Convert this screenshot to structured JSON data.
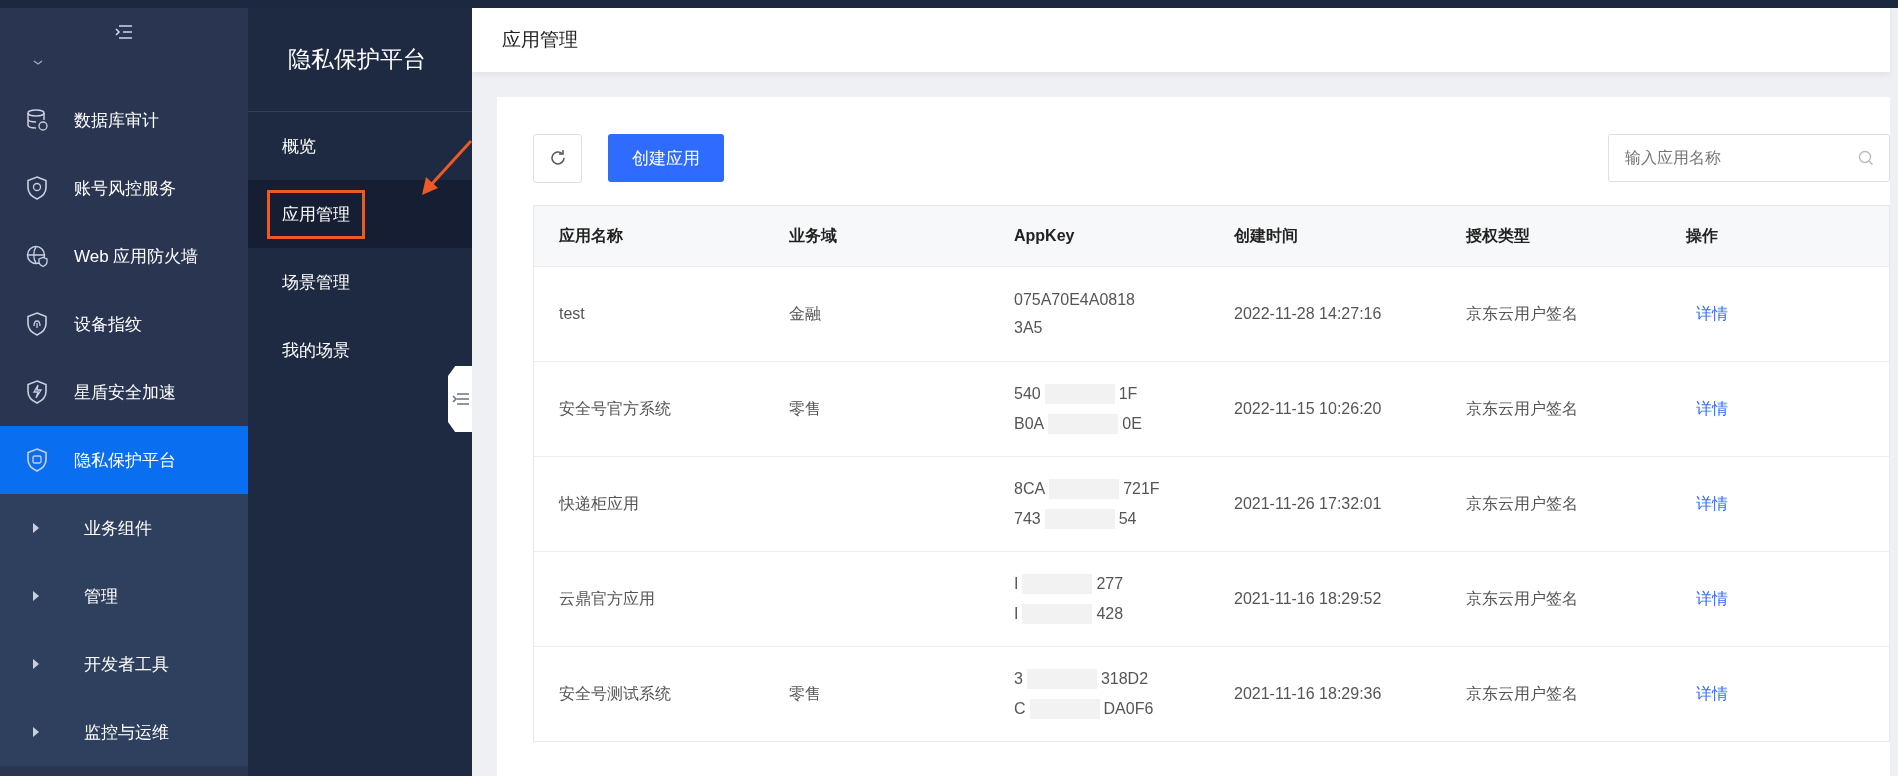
{
  "sidebar": {
    "items": [
      {
        "label": "数据库审计",
        "kind": "service",
        "selected": false
      },
      {
        "label": "账号风控服务",
        "kind": "service",
        "selected": false
      },
      {
        "label": "Web 应用防火墙",
        "kind": "service",
        "selected": false
      },
      {
        "label": "设备指纹",
        "kind": "service",
        "selected": false
      },
      {
        "label": "星盾安全加速",
        "kind": "service",
        "selected": false
      },
      {
        "label": "隐私保护平台",
        "kind": "service",
        "selected": true
      },
      {
        "label": "业务组件",
        "kind": "group",
        "expanded": false
      },
      {
        "label": "管理",
        "kind": "group",
        "expanded": false
      },
      {
        "label": "开发者工具",
        "kind": "group",
        "expanded": false
      },
      {
        "label": "监控与运维",
        "kind": "group",
        "expanded": false
      }
    ]
  },
  "subnav": {
    "title": "隐私保护平台",
    "items": [
      {
        "label": "概览",
        "selected": false,
        "annotated": false
      },
      {
        "label": "应用管理",
        "selected": true,
        "annotated": true
      },
      {
        "label": "场景管理",
        "selected": false,
        "annotated": false
      },
      {
        "label": "我的场景",
        "selected": false,
        "annotated": false
      }
    ]
  },
  "page": {
    "title": "应用管理"
  },
  "toolbar": {
    "create_button": "创建应用",
    "search": {
      "placeholder": "输入应用名称"
    }
  },
  "table": {
    "columns": [
      "应用名称",
      "业务域",
      "AppKey",
      "创建时间",
      "授权类型",
      "操作"
    ],
    "rows": [
      {
        "name": "test",
        "domain": "金融",
        "appkey": [
          [
            "075A70E4A0818"
          ],
          [
            "3A5"
          ]
        ],
        "created": "2022-11-28 14:27:16",
        "auth": "京东云用户签名",
        "action": "详情"
      },
      {
        "name": "安全号官方系统",
        "domain": "零售",
        "appkey": [
          [
            "540",
            "1F"
          ],
          [
            "B0A",
            "0E"
          ]
        ],
        "created": "2022-11-15 10:26:20",
        "auth": "京东云用户签名",
        "action": "详情"
      },
      {
        "name": "快递柜应用",
        "appkey": [
          [
            "8CA",
            "721F"
          ],
          [
            "743",
            "54"
          ]
        ],
        "created": "2021-11-26 17:32:01",
        "auth": "京东云用户签名",
        "action": "详情"
      },
      {
        "name": "云鼎官方应用",
        "appkey": [
          [
            "I",
            "277"
          ],
          [
            "I",
            "428"
          ]
        ],
        "created": "2021-11-16 18:29:52",
        "auth": "京东云用户签名",
        "action": "详情"
      },
      {
        "name": "安全号测试系统",
        "domain": "零售",
        "appkey": [
          [
            "3",
            "318D2"
          ],
          [
            "C",
            "DA0F6"
          ]
        ],
        "created": "2021-11-16 18:29:36",
        "auth": "京东云用户签名",
        "action": "详情"
      }
    ]
  }
}
